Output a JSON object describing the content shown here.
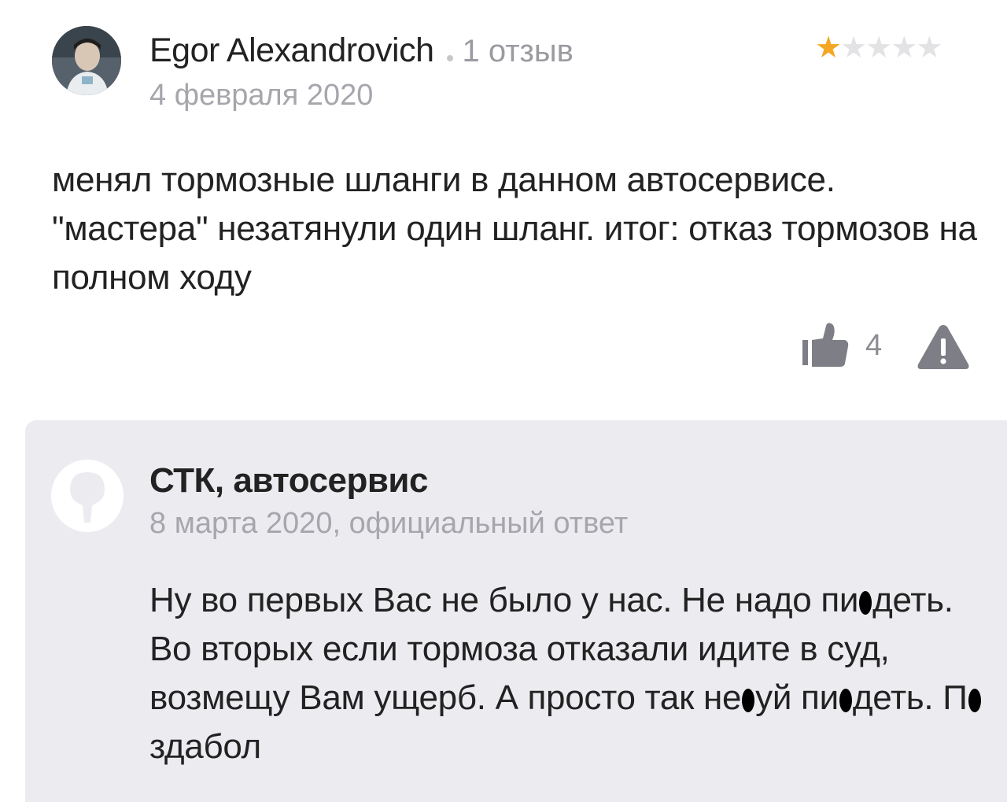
{
  "review": {
    "author_name": "Egor Alexandrovich",
    "review_count": "1 отзыв",
    "date": "4 февраля 2020",
    "rating": 1,
    "rating_max": 5,
    "text": "менял тормозные шланги в данном автосервисе. \"мастера\" незатянули один шланг. итог: отказ тормозов на полном ходу",
    "likes": "4",
    "icons": {
      "like": "thumbs-up-icon",
      "report": "warning-icon"
    },
    "colors": {
      "star_on": "#f5a623",
      "star_off": "#e3e3e6"
    }
  },
  "reply": {
    "org_name": "СТК, автосервис",
    "meta": "8 марта 2020, официальный ответ",
    "text_parts": [
      "Ну во первых Вас не было у нас. Не надо пи",
      "деть. Во вторых если тормоза отказали идите в суд, возмещу Вам ущерб. А просто так не",
      "уй пи",
      "деть. П",
      "здабол"
    ],
    "background": "#ececf0"
  }
}
